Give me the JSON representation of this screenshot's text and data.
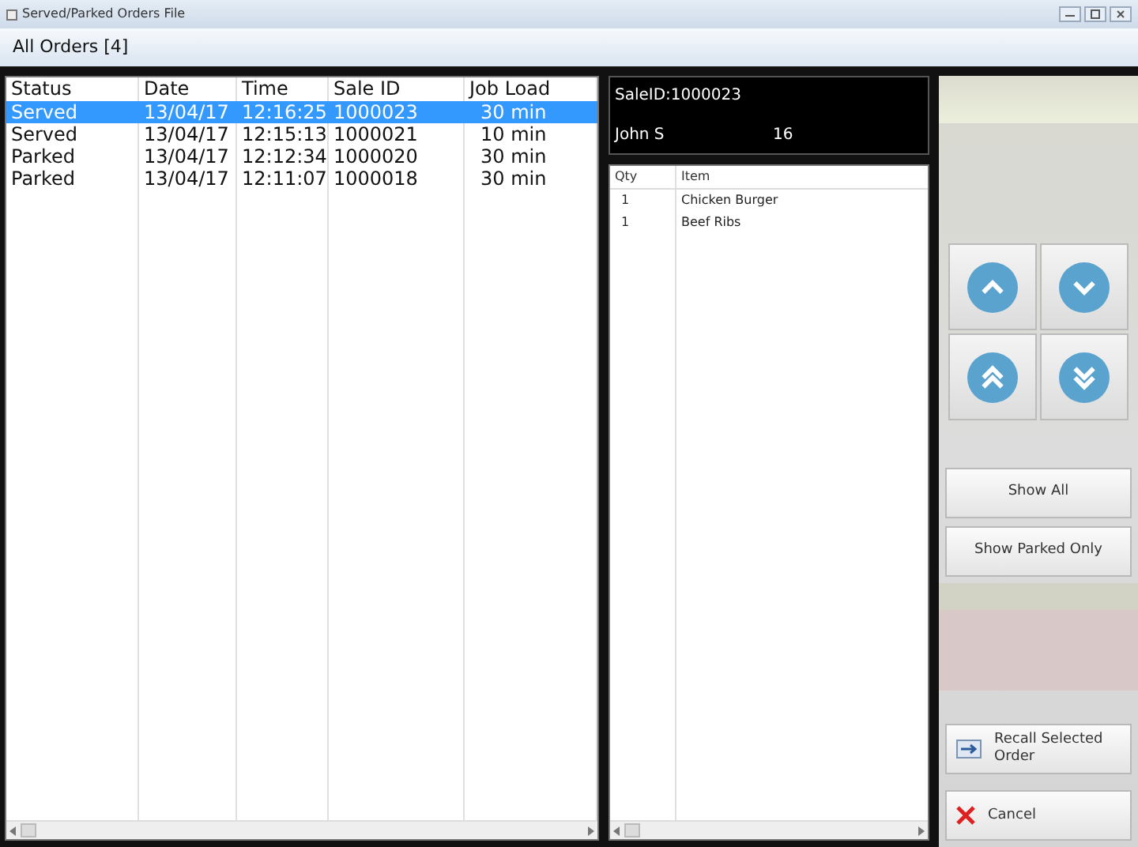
{
  "window": {
    "title": "Served/Parked Orders File"
  },
  "header": {
    "title": "All Orders [4]"
  },
  "orders": {
    "columns": [
      "Status",
      "Date",
      "Time",
      "Sale ID",
      "Job Load"
    ],
    "rows": [
      {
        "cells": [
          "Served",
          "13/04/17",
          "12:16:25",
          "1000023",
          "30 min"
        ],
        "selected": true
      },
      {
        "cells": [
          "Served",
          "13/04/17",
          "12:15:13",
          "1000021",
          "10 min"
        ],
        "selected": false
      },
      {
        "cells": [
          "Parked",
          "13/04/17",
          "12:12:34",
          "1000020",
          "30 min"
        ],
        "selected": false
      },
      {
        "cells": [
          "Parked",
          "13/04/17",
          "12:11:07",
          "1000018",
          "30 min"
        ],
        "selected": false
      }
    ]
  },
  "detail": {
    "sale_id": "SaleID:1000023",
    "customer": "John S",
    "number": "16",
    "columns": [
      "Qty",
      "Item"
    ],
    "rows": [
      {
        "cells": [
          "1",
          "Chicken Burger"
        ]
      },
      {
        "cells": [
          "1",
          "Beef Ribs"
        ]
      }
    ]
  },
  "nav_buttons": [
    {
      "kind": "up"
    },
    {
      "kind": "down"
    },
    {
      "kind": "top"
    },
    {
      "kind": "bottom"
    }
  ],
  "filter_buttons": [
    "Show All",
    "Show Parked Only"
  ],
  "actions": [
    {
      "kind": "recall",
      "label": "Recall Selected Order"
    },
    {
      "kind": "cancel",
      "label": "Cancel"
    }
  ]
}
